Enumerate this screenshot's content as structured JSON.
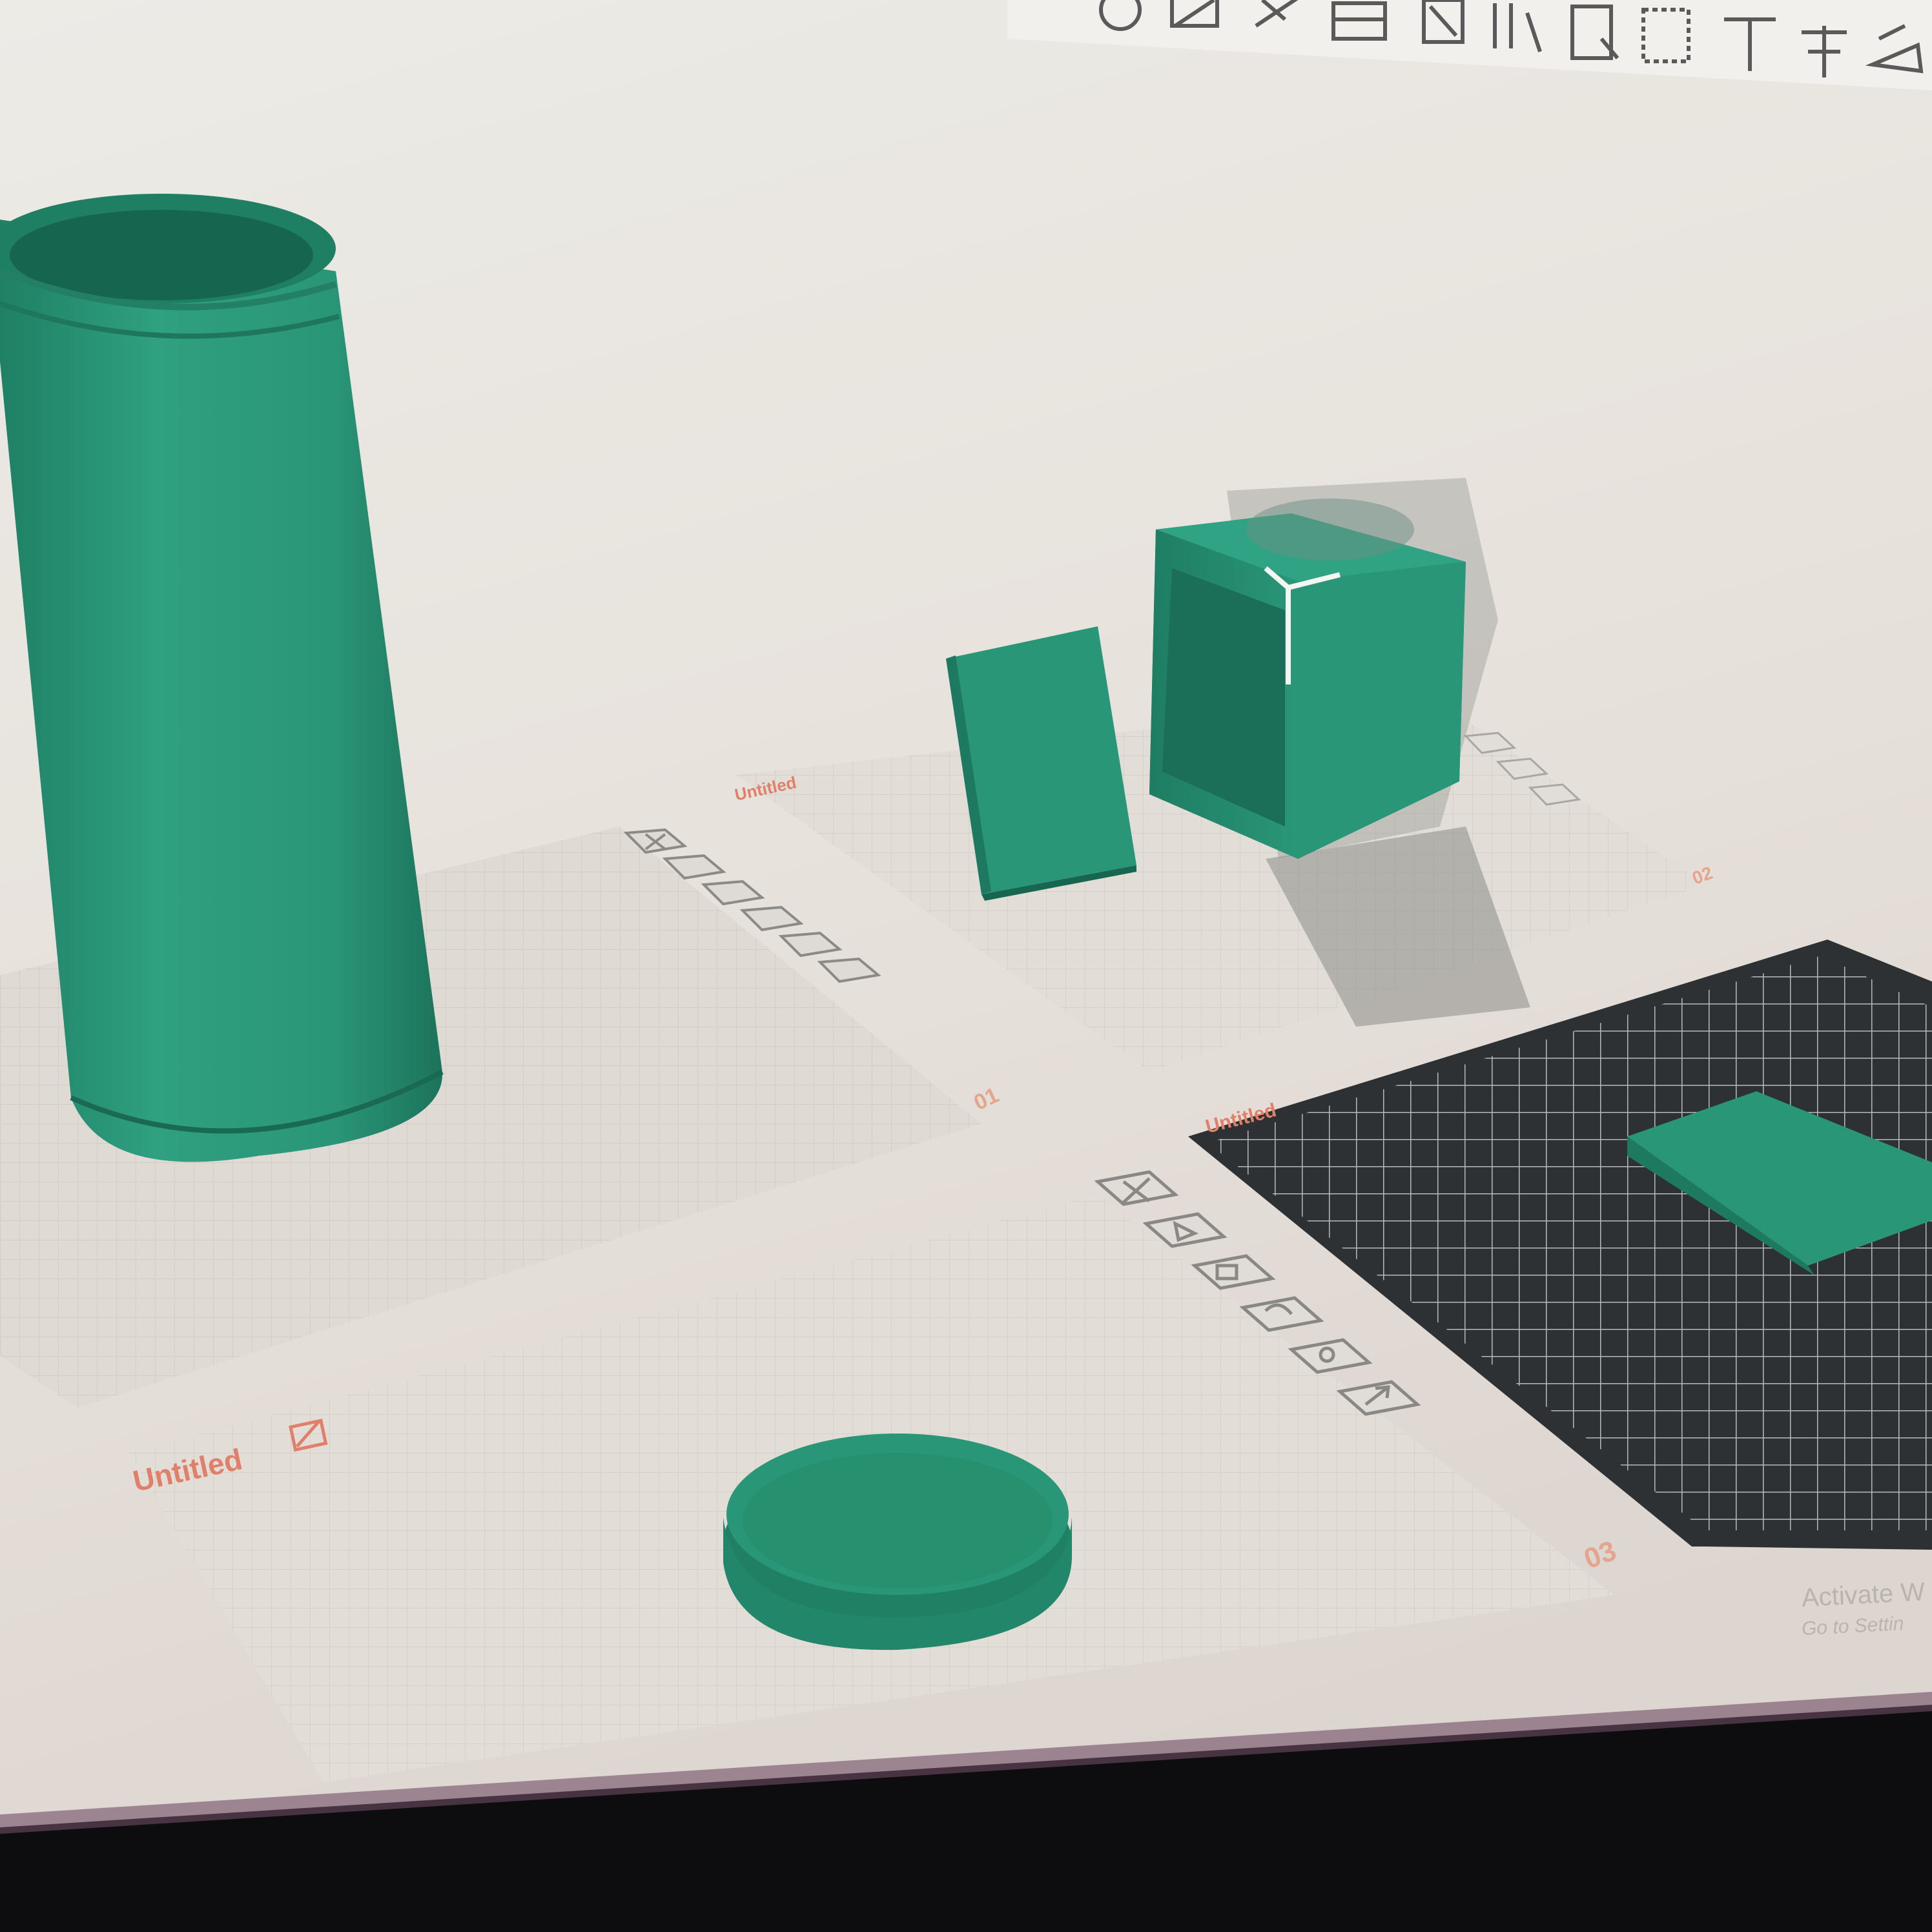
{
  "plates": [
    {
      "name": "",
      "number": "01"
    },
    {
      "name": "Untitled",
      "number": "02"
    },
    {
      "name": "Untitled",
      "number": "03"
    },
    {
      "name": "Untitled",
      "number": ""
    }
  ],
  "plate_toolbar_icons": [
    "close-icon",
    "orient-icon",
    "arrange-icon",
    "lock-icon",
    "settings-icon",
    "move-icon"
  ],
  "top_toolbar_icons": [
    "rotate-icon",
    "scale-icon",
    "cut-icon",
    "support-paint-icon",
    "seam-paint-icon",
    "fuzzy-skin-icon",
    "color-paint-icon",
    "text-icon",
    "measure-icon",
    "assembly-icon"
  ],
  "windows_watermark": {
    "line1": "Activate W",
    "line2": "Go to Settin"
  },
  "colors": {
    "model": "#2a9678",
    "model_dark": "#1d7a61",
    "canvas": "#e7e2dc",
    "grid": "#d3cec8",
    "plate_label": "#e0806a",
    "bed": "#2d3133"
  }
}
